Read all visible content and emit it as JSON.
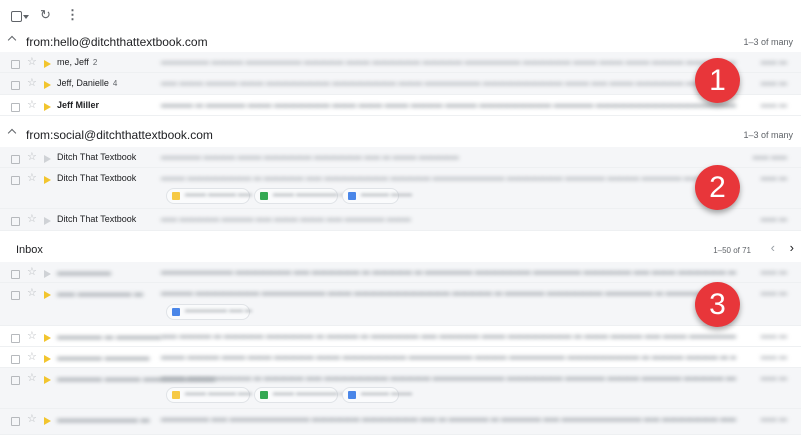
{
  "toolbar": {
    "select_icon": "checkbox-dropdown-icon",
    "refresh_icon": "refresh-icon",
    "more_icon": "more-vert-icon",
    "refresh_glyph": "↻",
    "more_glyph": "⋮"
  },
  "sections": [
    {
      "title": "from:hello@ditchthattextbook.com",
      "count": "1–3 of many"
    },
    {
      "title": "from:social@ditchthattextbook.com",
      "count": "1–3 of many"
    }
  ],
  "section1_rows": [
    {
      "sender": "me, Jeff",
      "count": "2"
    },
    {
      "sender": "Jeff, Danielle",
      "count": "4"
    },
    {
      "sender": "Jeff Miller",
      "count": ""
    }
  ],
  "section2_rows": [
    {
      "sender": "Ditch That Textbook"
    },
    {
      "sender": "Ditch That Textbook"
    },
    {
      "sender": "Ditch That Textbook"
    }
  ],
  "inbox": {
    "title": "Inbox",
    "range": "1–50 of 71",
    "prev_glyph": "‹",
    "next_glyph": "›"
  },
  "badges": [
    "1",
    "2",
    "3"
  ],
  "colors": {
    "badge": "#e8363a",
    "important": "#f2c52e",
    "chip_yellow": "#f6c944",
    "chip_green": "#34a853",
    "chip_blue": "#4a86e8"
  },
  "star_glyph": "☆"
}
